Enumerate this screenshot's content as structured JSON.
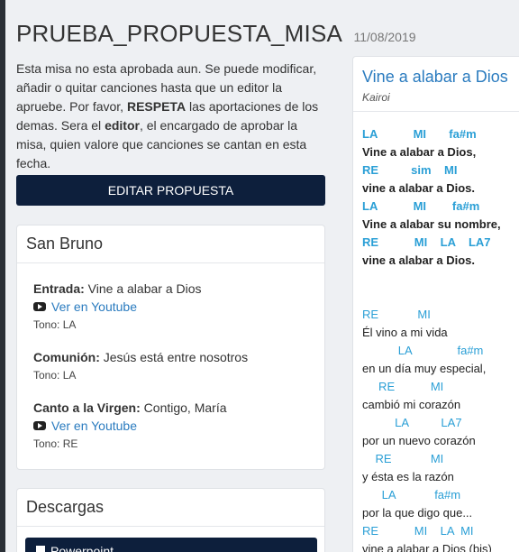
{
  "page": {
    "title": "PRUEBA_PROPUESTA_MISA",
    "date": "11/08/2019"
  },
  "notice": {
    "part1": "Esta misa no esta aprobada aun. Se puede modificar, añadir o quitar canciones hasta que un editor la apruebe. Por favor, ",
    "bold1": "RESPETA",
    "part2": " las aportaciones de los demas. Sera el ",
    "bold2": "editor",
    "part3": ", el encargado de aprobar la misa, quien valore que canciones se cantan en esta fecha."
  },
  "edit_button": "EDITAR PROPUESTA",
  "mass_card": {
    "title": "San Bruno",
    "songs": [
      {
        "label": "Entrada:",
        "song": " Vine a alabar a Dios",
        "youtube": "Ver en Youtube",
        "tono": "Tono:  LA"
      },
      {
        "label": "Comunión:",
        "song": " Jesús está entre nosotros",
        "tono": "Tono:  LA"
      },
      {
        "label": "Canto a la Virgen:",
        "song": " Contigo, María",
        "youtube": "Ver en Youtube",
        "tono": "Tono:  RE"
      }
    ]
  },
  "downloads": {
    "title": "Descargas",
    "powerpoint": "Powerpoint"
  },
  "song_panel": {
    "title": "Vine a alabar a Dios",
    "author": "Kairoi",
    "lines": [
      {
        "text": "LA           MI       fa#m",
        "kind": "chord",
        "bold": true
      },
      {
        "text": "Vine a alabar a Dios,",
        "kind": "text",
        "bold": true
      },
      {
        "text": "RE          sim    MI",
        "kind": "chord",
        "bold": true
      },
      {
        "text": "vine a alabar a Dios.",
        "kind": "text",
        "bold": true
      },
      {
        "text": "LA           MI        fa#m",
        "kind": "chord",
        "bold": true
      },
      {
        "text": "Vine a alabar su nombre,",
        "kind": "text",
        "bold": true
      },
      {
        "text": "RE           MI    LA    LA7",
        "kind": "chord",
        "bold": true
      },
      {
        "text": "vine a alabar a Dios.",
        "kind": "text",
        "bold": true
      },
      {
        "text": "",
        "kind": "text",
        "bold": false
      },
      {
        "text": "",
        "kind": "text",
        "bold": false
      },
      {
        "text": "RE            MI",
        "kind": "chord",
        "bold": false
      },
      {
        "text": "Él vino a mi vida",
        "kind": "text",
        "bold": false
      },
      {
        "text": "           LA              fa#m",
        "kind": "chord",
        "bold": false
      },
      {
        "text": "en un día muy especial,",
        "kind": "text",
        "bold": false
      },
      {
        "text": "     RE           MI",
        "kind": "chord",
        "bold": false
      },
      {
        "text": "cambió mi corazón",
        "kind": "text",
        "bold": false
      },
      {
        "text": "          LA          LA7",
        "kind": "chord",
        "bold": false
      },
      {
        "text": "por un nuevo corazón",
        "kind": "text",
        "bold": false
      },
      {
        "text": "    RE            MI",
        "kind": "chord",
        "bold": false
      },
      {
        "text": "y ésta es la razón",
        "kind": "text",
        "bold": false
      },
      {
        "text": "      LA            fa#m",
        "kind": "chord",
        "bold": false
      },
      {
        "text": "por la que digo que...",
        "kind": "text",
        "bold": false
      },
      {
        "text": "RE           MI    LA  MI",
        "kind": "chord",
        "bold": false
      },
      {
        "text": "vine a alabar a Dios (bis)",
        "kind": "text",
        "bold": false
      }
    ]
  }
}
